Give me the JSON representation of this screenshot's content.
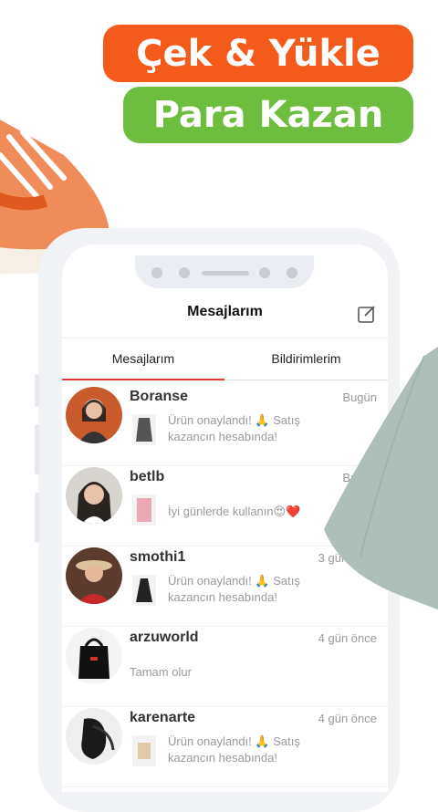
{
  "promo": {
    "line1": "Çek & Yükle",
    "line2": "Para Kazan"
  },
  "header": {
    "title": "Mesajlarım"
  },
  "tabs": [
    {
      "label": "Mesajlarım"
    },
    {
      "label": "Bildirimlerim"
    }
  ],
  "messages": [
    {
      "name": "Boranse",
      "time": "Bugün",
      "text": "Ürün onaylandı! 🙏 Satış kazancın hesabında!"
    },
    {
      "name": "betlb",
      "time": "Bugün",
      "text": "İyi günlerde kullanın😍❤️"
    },
    {
      "name": "smothi1",
      "time": "3 gün önce",
      "text": "Ürün onaylandı! 🙏 Satış kazancın hesabında!"
    },
    {
      "name": "arzuworld",
      "time": "4 gün önce",
      "text": "Tamam olur"
    },
    {
      "name": "karenarte",
      "time": "4 gün önce",
      "text": "Ürün onaylandı! 🙏 Satış kazancın hesabında!"
    }
  ],
  "colors": {
    "orange": "#f45a1a",
    "green": "#6dbd3e",
    "accent": "#e23b3b"
  }
}
